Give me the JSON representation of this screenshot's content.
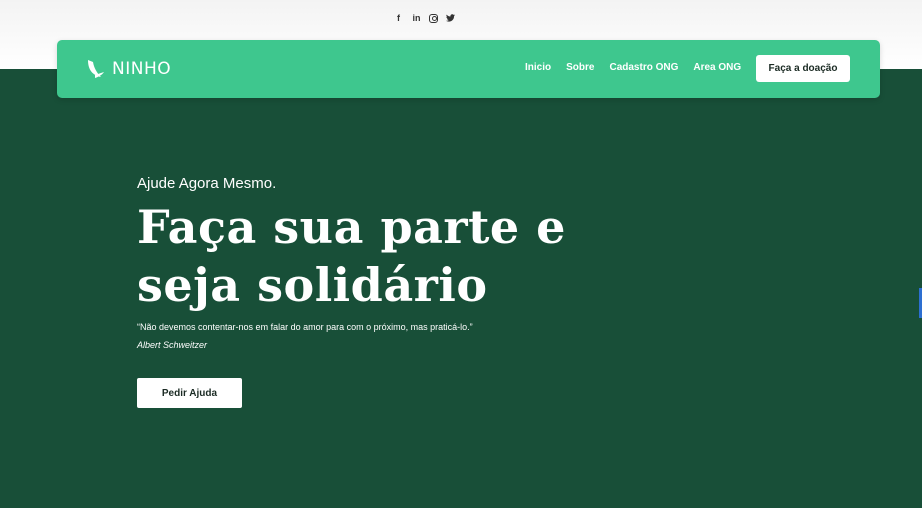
{
  "social": {
    "facebook": "f",
    "linkedin": "in",
    "twitter": "t"
  },
  "brand": {
    "name": "NINHO"
  },
  "nav": {
    "items": [
      "Inicio",
      "Sobre",
      "Cadastro ONG",
      "Area ONG"
    ],
    "cta": "Faça a doação"
  },
  "hero": {
    "eyebrow": "Ajude Agora Mesmo.",
    "headline_line1": "Faça sua parte e",
    "headline_line2": "seja solidário",
    "quote": "“Não devemos contentar-nos em falar do amor para com o próximo, mas praticá-lo.”",
    "author": "Albert Schweitzer",
    "button": "Pedir Ajuda"
  },
  "colors": {
    "background": "#184f38",
    "navbar": "#3ec78e",
    "button": "#ffffff"
  }
}
